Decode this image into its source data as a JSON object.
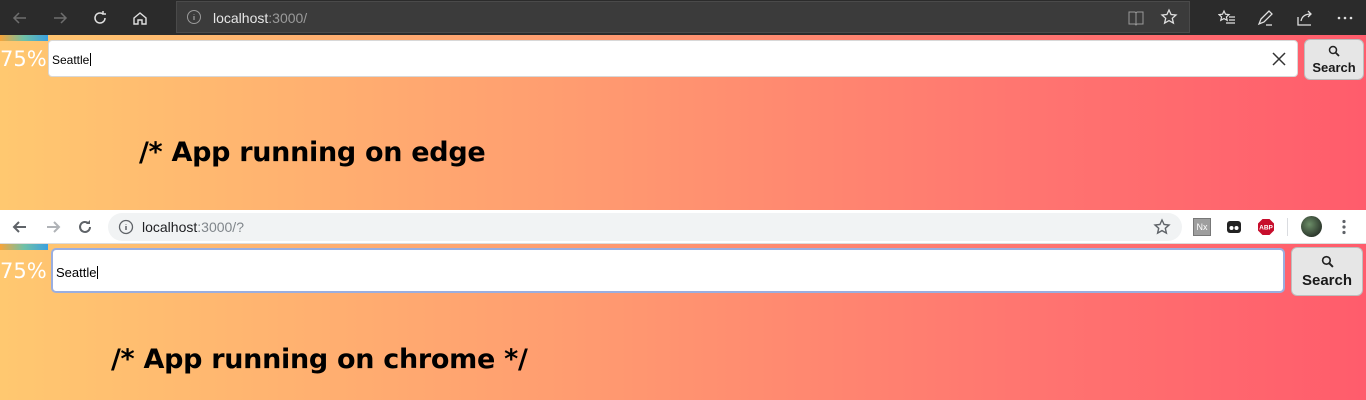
{
  "edge": {
    "url_host": "localhost",
    "url_rest": ":3000/",
    "zoom": "75%",
    "search_value": "Seattle",
    "search_button_label": "Search",
    "caption": "/* App running on edge"
  },
  "chrome": {
    "url_host": "localhost",
    "url_rest": ":3000/?",
    "zoom": "75%",
    "search_value": "Seattle",
    "search_button_label": "Search",
    "caption": "/* App running on chrome */",
    "extensions": [
      "Nx",
      "ABP"
    ]
  },
  "icons": [
    "back-icon",
    "forward-icon",
    "refresh-icon",
    "home-icon",
    "info-icon",
    "reading-view-icon",
    "star-icon",
    "favorites-icon",
    "pen-icon",
    "share-icon",
    "more-icon",
    "clear-icon",
    "search-icon"
  ],
  "colors": {
    "gradient_start": "#ffc870",
    "gradient_end": "#ff5c6c",
    "edge_bar": "#2b2b2b"
  }
}
